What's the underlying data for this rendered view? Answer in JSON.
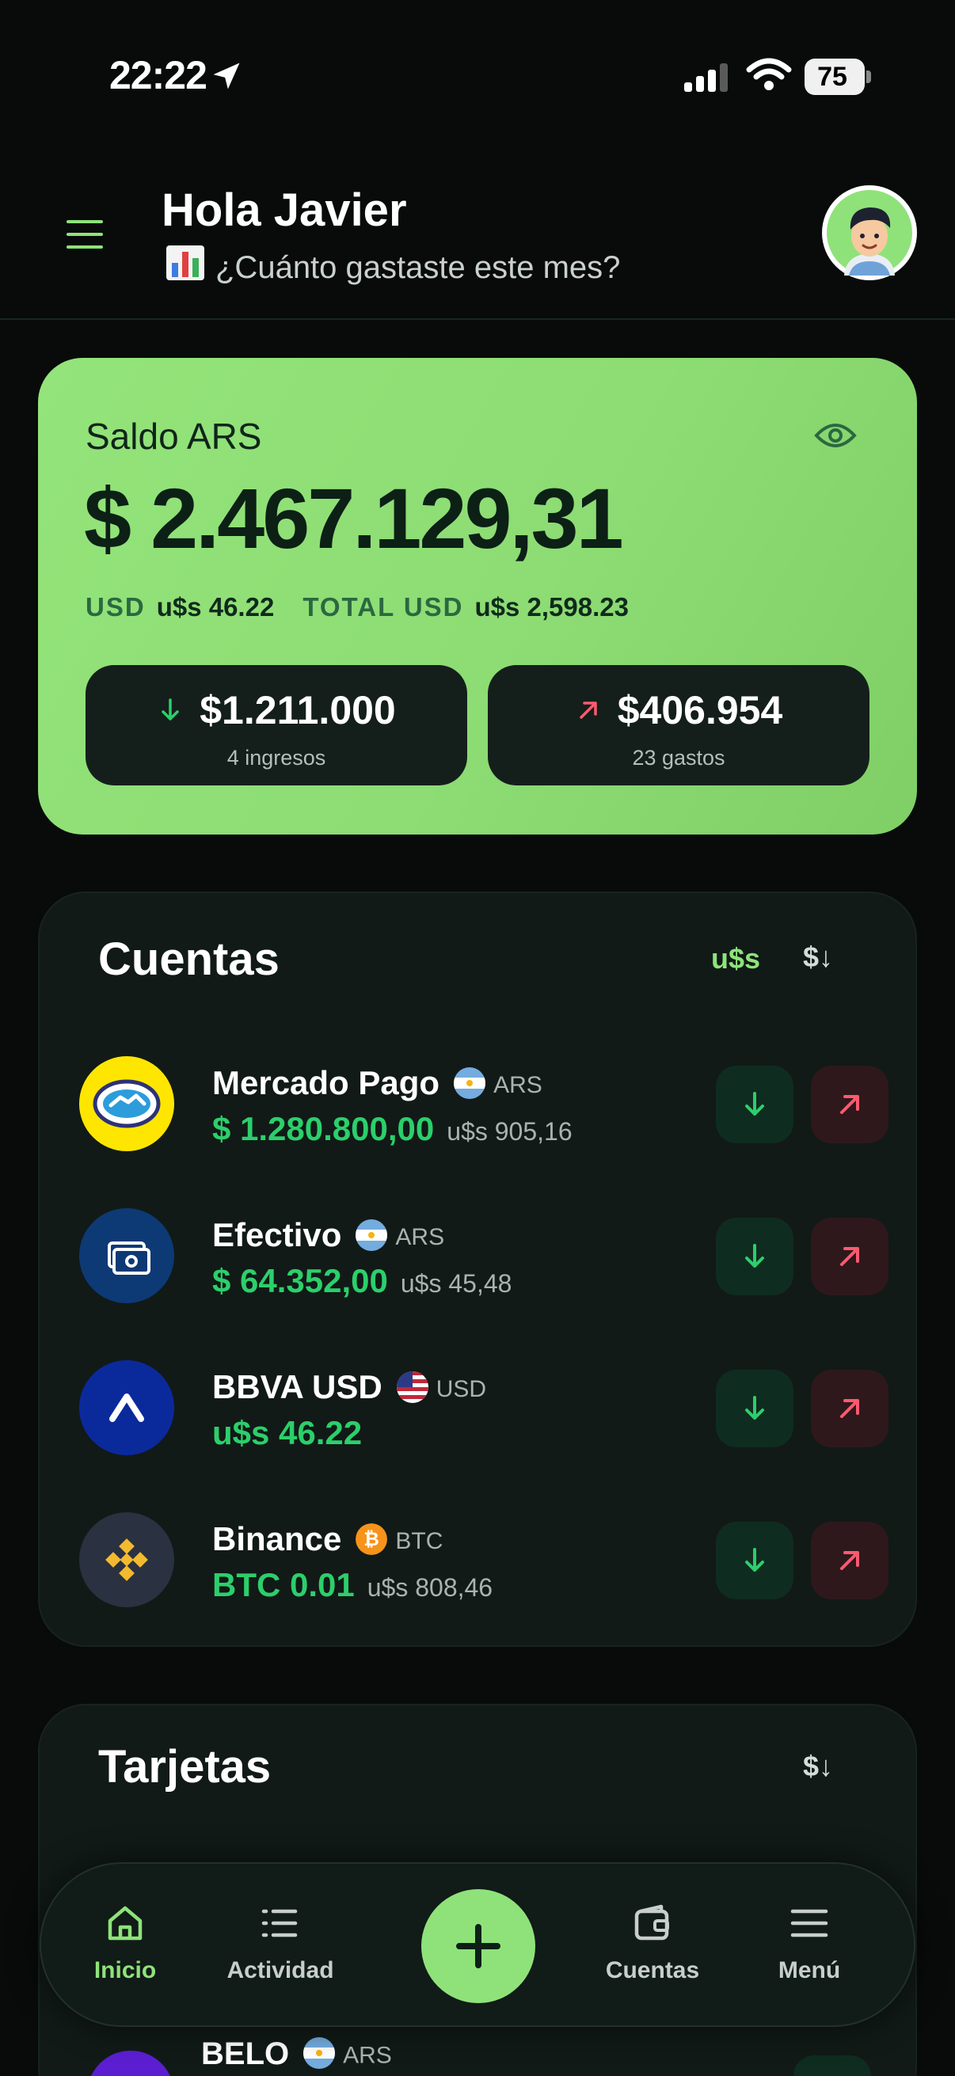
{
  "status_bar": {
    "time": "22:22",
    "battery": "75"
  },
  "header": {
    "greeting": "Hola Javier",
    "subtitle": "¿Cuánto gastaste este mes?"
  },
  "balance": {
    "label": "Saldo ARS",
    "amount": "$ 2.467.129,31",
    "usd_label": "USD",
    "usd_value": "u$s 46.22",
    "total_usd_label": "TOTAL USD",
    "total_usd_value": "u$s 2,598.23",
    "income": {
      "amount": "$1.211.000",
      "count": "4 ingresos"
    },
    "expenses": {
      "amount": "$406.954",
      "count": "23 gastos"
    }
  },
  "accounts": {
    "title": "Cuentas",
    "currency_toggle": "u$s",
    "sort_label": "$↓",
    "items": [
      {
        "name": "Mercado Pago",
        "currency": "ARS",
        "amount": "$ 1.280.800,00",
        "usd": "u$s 905,16",
        "icon": "handshake-icon"
      },
      {
        "name": "Efectivo",
        "currency": "ARS",
        "amount": "$ 64.352,00",
        "usd": "u$s 45,48",
        "icon": "cash-icon"
      },
      {
        "name": "BBVA USD",
        "currency": "USD",
        "amount": "u$s 46.22",
        "usd": "",
        "icon": "bbva-caret-icon"
      },
      {
        "name": "Binance",
        "currency": "BTC",
        "amount": "BTC 0.01",
        "usd": "u$s 808,46",
        "icon": "binance-icon"
      }
    ]
  },
  "cards": {
    "title": "Tarjetas",
    "sort_label": "$↓",
    "peek_item": {
      "name": "BELO",
      "currency": "ARS"
    }
  },
  "nav": {
    "items": [
      {
        "label": "Inicio",
        "icon": "home-icon",
        "active": true
      },
      {
        "label": "Actividad",
        "icon": "list-icon"
      },
      {
        "label": "Cuentas",
        "icon": "wallet-icon"
      },
      {
        "label": "Menú",
        "icon": "hamburger-icon"
      }
    ],
    "fab_icon": "plus-icon"
  },
  "colors": {
    "accent": "#8fe27a",
    "income": "#2ccf6b",
    "expense": "#ff5a6e",
    "background": "#080b0a"
  }
}
